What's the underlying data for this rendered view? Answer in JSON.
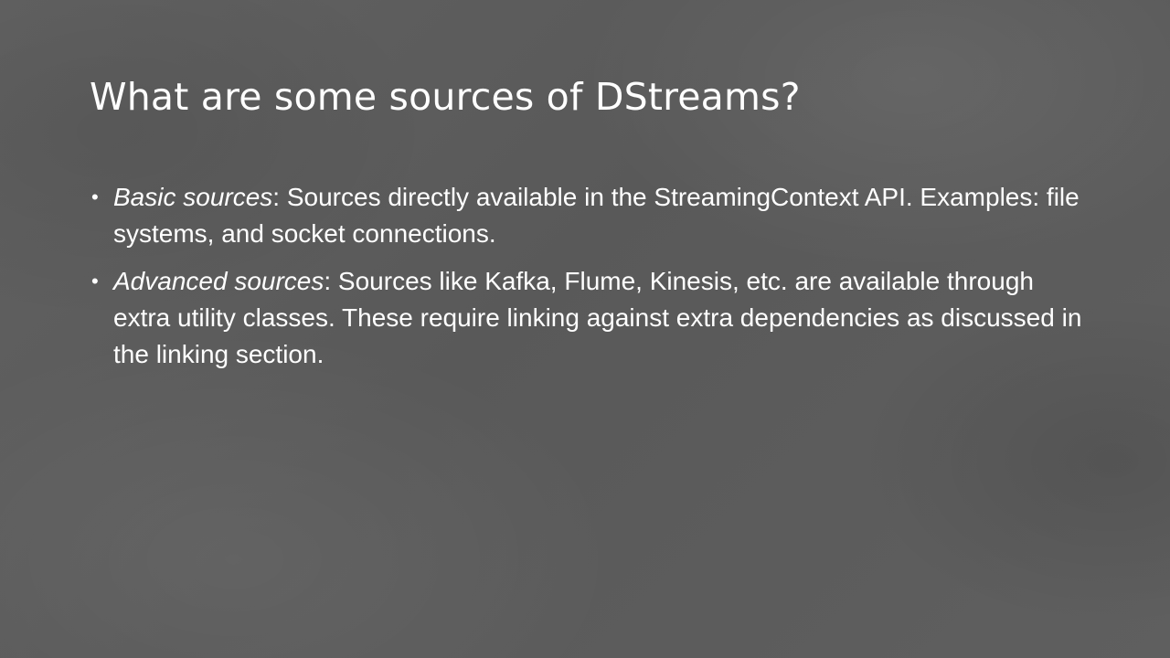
{
  "slide": {
    "title": "What are some sources of DStreams?",
    "bullets": [
      {
        "term": "Basic sources",
        "text": ": Sources directly available in the StreamingContext API. Examples: file systems, and socket connections."
      },
      {
        "term": "Advanced sources",
        "text": ": Sources like Kafka, Flume, Kinesis, etc. are available through extra utility classes. These require linking against extra dependencies as discussed in the linking section."
      }
    ],
    "bullet_glyph": "•"
  }
}
